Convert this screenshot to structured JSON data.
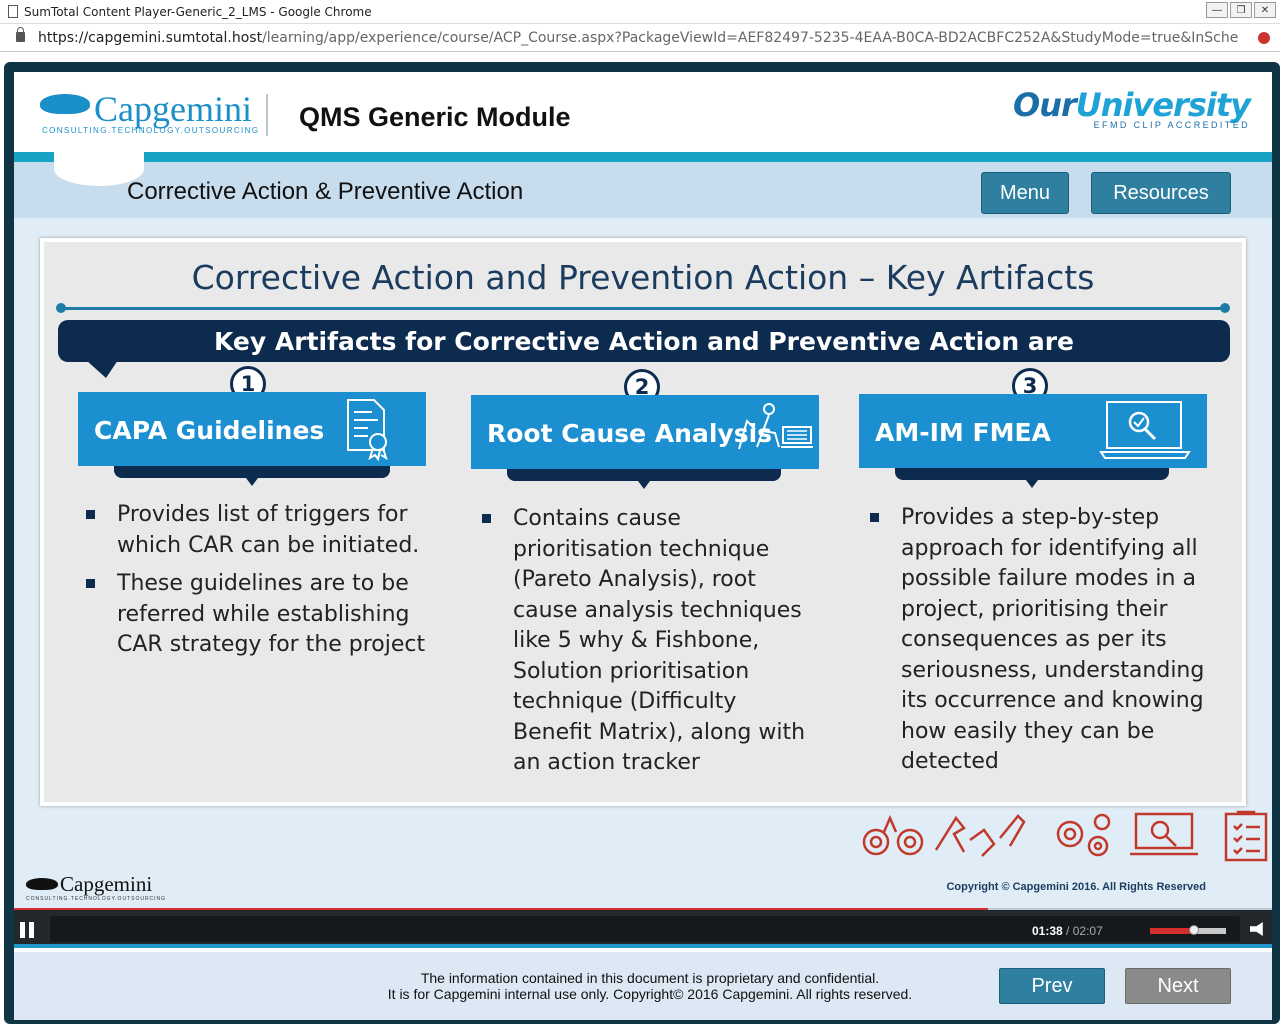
{
  "browser": {
    "window_title": "SumTotal Content Player-Generic_2_LMS - Google Chrome",
    "url_host": "https://capgemini.sumtotal.host",
    "url_path": "/learning/app/experience/course/ACP_Course.aspx?PackageViewId=AEF82497-5235-4EAA-B0CA-BD2ACBFC252A&StudyMode=true&InSchedule=true&Preview..."
  },
  "header": {
    "brand": "Capgemini",
    "brand_tagline": "CONSULTING.TECHNOLOGY.OUTSOURCING",
    "module_title": "QMS Generic Module",
    "partner_logo_a": "Our",
    "partner_logo_b": "University",
    "partner_tagline": "EFMD CLIP ACCREDITED"
  },
  "subheader": {
    "section_title": "Corrective Action & Preventive Action",
    "menu_label": "Menu",
    "resources_label": "Resources"
  },
  "slide": {
    "title": "Corrective Action and Prevention Action – Key Artifacts",
    "banner": "Key Artifacts for Corrective Action and Preventive Action are",
    "columns": [
      {
        "number": "1",
        "heading": "CAPA Guidelines",
        "icon": "certificate-document-icon",
        "bullets": [
          "Provides list of triggers for which CAR can be initiated.",
          "These guidelines are to be referred while establishing CAR strategy for the project"
        ]
      },
      {
        "number": "2",
        "heading": "Root Cause Analysis",
        "icon": "analyst-at-desk-icon",
        "bullets": [
          "Contains cause prioritisation technique (Pareto Analysis), root cause analysis techniques like 5 why & Fishbone, Solution prioritisation technique (Difficulty Benefit Matrix), along with an action tracker"
        ]
      },
      {
        "number": "3",
        "heading": "AM-IM FMEA",
        "icon": "laptop-magnifier-icon",
        "bullets": [
          "Provides a step-by-step approach for identifying all possible failure modes in a project, prioritising their consequences as per its seriousness, understanding its occurrence and knowing how easily they can be detected"
        ]
      }
    ]
  },
  "footer": {
    "brand": "Capgemini",
    "brand_tagline": "CONSULTING.TECHNOLOGY.OUTSOURCING",
    "copyright": "Copyright © Capgemini 2016. All Rights Reserved",
    "slide_progress_fraction": 0.774
  },
  "player": {
    "current_time": "01:38",
    "separator": "/",
    "duration": "02:07",
    "volume_fraction": 0.58
  },
  "bottom": {
    "disclaimer_line1": "The information contained in this document is proprietary and confidential.",
    "disclaimer_line2": "It is for Capgemini internal use only. Copyright© 2016 Capgemini. All rights reserved.",
    "prev_label": "Prev",
    "next_label": "Next"
  },
  "colors": {
    "accent": "#1b8fd0",
    "navy": "#0d2a4f",
    "prev_button": "#2e7fa0",
    "next_button": "#8a8a8a",
    "progress": "#d32f2f"
  }
}
